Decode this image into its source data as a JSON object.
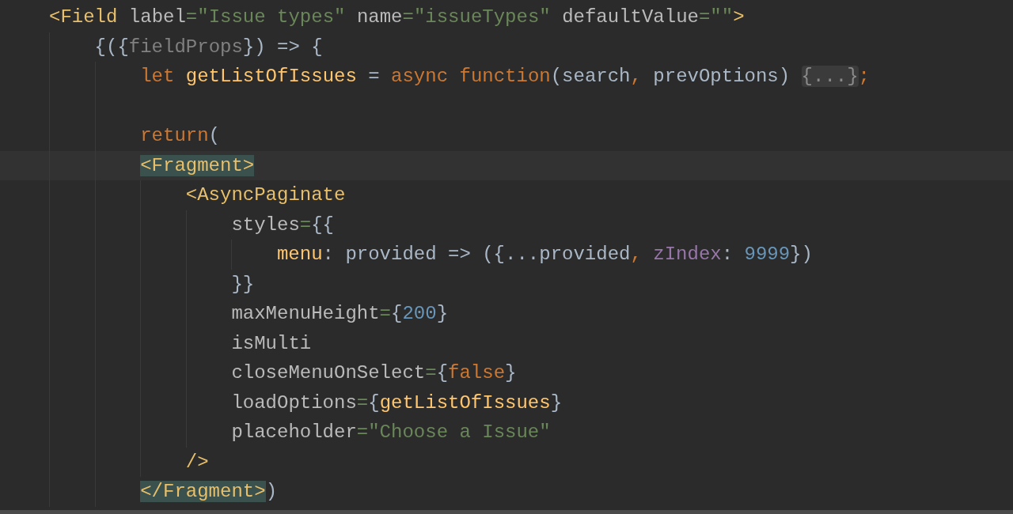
{
  "editor": {
    "lines": [
      {
        "kind": "code",
        "tokens": [
          {
            "text": "<Field",
            "kind": "tag"
          },
          {
            "text": " label",
            "kind": "attr"
          },
          {
            "text": "=\"Issue types\"",
            "kind": "string"
          },
          {
            "text": " name",
            "kind": "attr"
          },
          {
            "text": "=\"issueTypes\"",
            "kind": "string"
          },
          {
            "text": " defaultValue",
            "kind": "attr"
          },
          {
            "text": "=\"\"",
            "kind": "string"
          },
          {
            "text": ">",
            "kind": "tag"
          }
        ],
        "children": [
          {
            "kind": "code",
            "tokens": [
              {
                "text": "{({",
                "kind": "plain"
              },
              {
                "text": "fieldProps",
                "kind": "param"
              },
              {
                "text": "}) => {",
                "kind": "plain"
              }
            ],
            "children": [
              {
                "kind": "code",
                "tokens": [
                  {
                    "text": "let ",
                    "kind": "keyword"
                  },
                  {
                    "text": "getListOfIssues",
                    "kind": "function"
                  },
                  {
                    "text": " = ",
                    "kind": "plain"
                  },
                  {
                    "text": "async function",
                    "kind": "keyword"
                  },
                  {
                    "text": "(search",
                    "kind": "plain"
                  },
                  {
                    "text": ", ",
                    "kind": "keyword"
                  },
                  {
                    "text": "prevOptions) ",
                    "kind": "plain"
                  },
                  {
                    "text": "{...}",
                    "kind": "fold"
                  },
                  {
                    "text": ";",
                    "kind": "keyword"
                  }
                ]
              },
              {
                "kind": "blank"
              },
              {
                "kind": "code",
                "tokens": [
                  {
                    "text": "return",
                    "kind": "keyword"
                  },
                  {
                    "text": "(",
                    "kind": "plain"
                  }
                ]
              },
              {
                "kind": "current_line",
                "tokens": [
                  {
                    "text": "<Fragment>",
                    "kind": "matched_tag"
                  }
                ],
                "children": [
                  {
                    "kind": "code",
                    "tokens": [
                      {
                        "text": "<AsyncPaginate",
                        "kind": "tag"
                      }
                    ],
                    "children": [
                      {
                        "kind": "code",
                        "tokens": [
                          {
                            "text": "styles",
                            "kind": "attr"
                          },
                          {
                            "text": "=",
                            "kind": "string"
                          },
                          {
                            "text": "{{",
                            "kind": "plain"
                          }
                        ],
                        "children": [
                          {
                            "kind": "code",
                            "tokens": [
                              {
                                "text": "menu",
                                "kind": "function"
                              },
                              {
                                "text": ": provided => ({...provided",
                                "kind": "plain"
                              },
                              {
                                "text": ", ",
                                "kind": "keyword"
                              },
                              {
                                "text": "zIndex",
                                "kind": "property"
                              },
                              {
                                "text": ": ",
                                "kind": "plain"
                              },
                              {
                                "text": "9999",
                                "kind": "number"
                              },
                              {
                                "text": "})",
                                "kind": "plain"
                              }
                            ]
                          }
                        ]
                      },
                      {
                        "kind": "code",
                        "tokens": [
                          {
                            "text": "}}",
                            "kind": "plain"
                          }
                        ]
                      },
                      {
                        "kind": "code",
                        "tokens": [
                          {
                            "text": "maxMenuHeight",
                            "kind": "attr"
                          },
                          {
                            "text": "=",
                            "kind": "string"
                          },
                          {
                            "text": "{",
                            "kind": "plain"
                          },
                          {
                            "text": "200",
                            "kind": "number"
                          },
                          {
                            "text": "}",
                            "kind": "plain"
                          }
                        ]
                      },
                      {
                        "kind": "code",
                        "tokens": [
                          {
                            "text": "isMulti",
                            "kind": "attr"
                          }
                        ]
                      },
                      {
                        "kind": "code",
                        "tokens": [
                          {
                            "text": "closeMenuOnSelect",
                            "kind": "attr"
                          },
                          {
                            "text": "=",
                            "kind": "string"
                          },
                          {
                            "text": "{",
                            "kind": "plain"
                          },
                          {
                            "text": "false",
                            "kind": "keyword"
                          },
                          {
                            "text": "}",
                            "kind": "plain"
                          }
                        ]
                      },
                      {
                        "kind": "code",
                        "tokens": [
                          {
                            "text": "loadOptions",
                            "kind": "attr"
                          },
                          {
                            "text": "=",
                            "kind": "string"
                          },
                          {
                            "text": "{",
                            "kind": "plain"
                          },
                          {
                            "text": "getListOfIssues",
                            "kind": "function"
                          },
                          {
                            "text": "}",
                            "kind": "plain"
                          }
                        ]
                      },
                      {
                        "kind": "code",
                        "tokens": [
                          {
                            "text": "placeholder",
                            "kind": "attr"
                          },
                          {
                            "text": "=\"Choose a Issue\"",
                            "kind": "string"
                          }
                        ]
                      }
                    ]
                  },
                  {
                    "kind": "code",
                    "tokens": [
                      {
                        "text": "/>",
                        "kind": "tag"
                      }
                    ]
                  }
                ]
              },
              {
                "kind": "code",
                "tokens": [
                  {
                    "text": "</Fragment>",
                    "kind": "matched_tag"
                  },
                  {
                    "text": ")",
                    "kind": "plain"
                  }
                ]
              }
            ]
          }
        ]
      }
    ]
  }
}
